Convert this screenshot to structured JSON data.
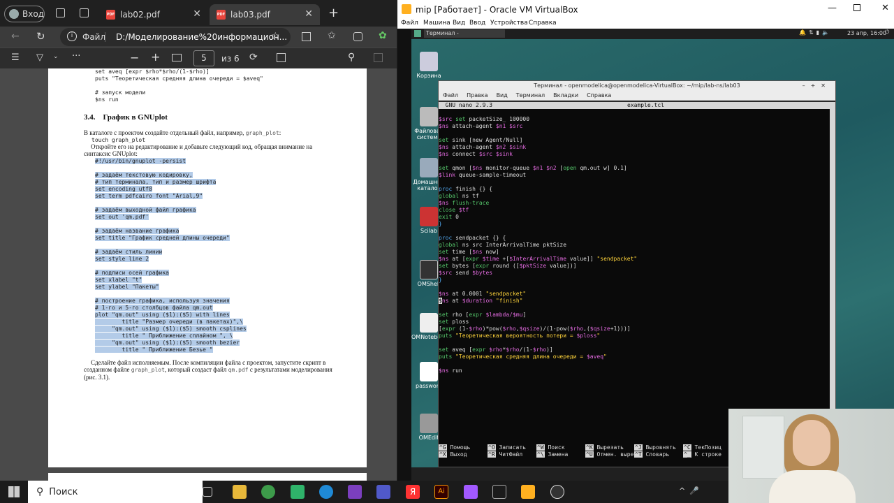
{
  "browser": {
    "login": "Вход",
    "tabs": [
      {
        "label": "lab02.pdf",
        "active": false
      },
      {
        "label": "lab03.pdf",
        "active": true
      }
    ],
    "address_prefix": "Файл",
    "address": "D:/Моделирование%20информацион...",
    "page_current": "5",
    "page_total": "из 6"
  },
  "pdf": {
    "top_code": [
      "set aveq [expr $rho*$rho/(1-$rho)]",
      "puts \"Теоретическая средняя длина очереди = $aveq\"",
      "",
      "# запуск модели",
      "$ns run"
    ],
    "section": "3.4.    График в GNUplot",
    "p1": "В каталоге с проектом создайте отдельный файл, например, ",
    "p1_code": "graph_plot",
    "p1_end": ":",
    "touch": "touch graph_plot",
    "p2": "Откройте его на редактирование и добавьте следующий код, обращая внимание на синтаксис GNUplot:",
    "code": [
      "#!/usr/bin/gnuplot -persist",
      "",
      "# задаём текстовую кодировку,",
      "# тип терминала, тип и размер шрифта",
      "set encoding utf8",
      "set term pdfcairo font \"Arial,9\"",
      "",
      "# задаём выходной файл графика",
      "set out 'qm.pdf'",
      "",
      "# задаём название графика",
      "set title \"График средней длины очереди\"",
      "",
      "# задаём стиль линии",
      "set style line 2",
      "",
      "# подписи осей графика",
      "set xlabel \"t\"",
      "set ylabel \"Пакеты\"",
      "",
      "# построение графика, используя значения",
      "# 1-го и 5-го столбцов файла qm.out",
      "plot \"qm.out\" using ($1):($5) with lines",
      "        title \"Размер очереди (в пакетах)\",\\",
      "     \"qm.out\" using ($1):($5) smooth csplines",
      "        title \" Приближение сплайном \", \\",
      "     \"qm.out\" using ($1):($5) smooth bezier",
      "        title \" Приближение Безье \""
    ],
    "p3a": "Сделайте файл исполняемым. После компиляции файла с проектом, запустите скрипт в созданном файле ",
    "p3_code1": "graph_plot",
    "p3b": ", который создаст файл ",
    "p3_code2": "qm.pdf",
    "p3c": " с результатами моделирования (рис. 3.1)."
  },
  "vbox": {
    "title": "mip [Работает] - Oracle VM VirtualBox",
    "menu": [
      "Файл",
      "Машина",
      "Вид",
      "Ввод",
      "Устройства",
      "Справка"
    ],
    "panel_task": "Терминал - openmodelica@...",
    "panel_clock": "23 апр, 16:00",
    "desktop_icons": [
      "Корзина",
      "Файловая система",
      "Домашний каталог",
      "Scilab",
      "OMShell",
      "OMNotebook",
      "password",
      "OMEdit"
    ]
  },
  "terminal": {
    "title": "Терминал - openmodelica@openmodelica-VirtualBox: ~/mip/lab-ns/lab03",
    "menu": [
      "Файл",
      "Правка",
      "Вид",
      "Терминал",
      "Вкладки",
      "Справка"
    ],
    "nano_version": "  GNU nano 2.9.3",
    "filename": "example.tcl",
    "footer_row1": [
      [
        "^G",
        "Помощь"
      ],
      [
        "^O",
        "Записать"
      ],
      [
        "^W",
        "Поиск"
      ],
      [
        "^K",
        "Вырезать"
      ],
      [
        "^J",
        "Выровнять"
      ],
      [
        "^C",
        "ТекПозиц"
      ]
    ],
    "footer_row2": [
      [
        "^X",
        "Выход"
      ],
      [
        "^R",
        "ЧитФайл"
      ],
      [
        "^\\",
        "Замена"
      ],
      [
        "^U",
        "Отмен. вырез"
      ],
      [
        "^T",
        "Словарь"
      ],
      [
        "^_",
        "К строке"
      ]
    ]
  },
  "taskbar": {
    "search": "Поиск"
  }
}
